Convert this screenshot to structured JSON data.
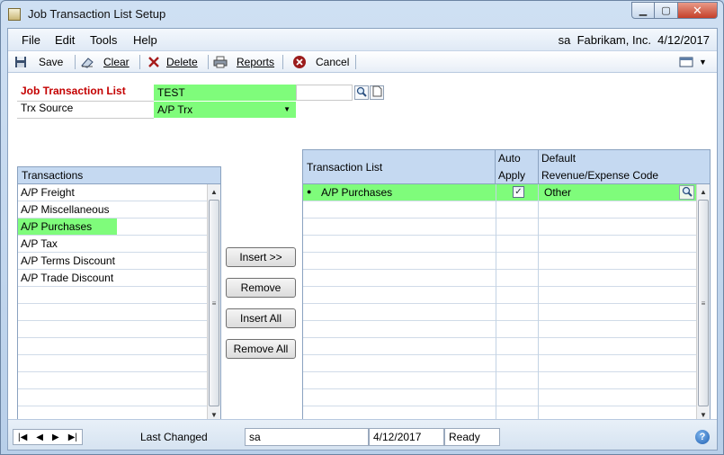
{
  "window": {
    "title": "Job Transaction List Setup"
  },
  "menu": {
    "items": [
      "File",
      "Edit",
      "Tools",
      "Help"
    ],
    "company": "sa  Fabrikam, Inc.  4/12/2017"
  },
  "toolbar": {
    "save": "Save",
    "clear": "Clear",
    "delete": "Delete",
    "reports": "Reports",
    "cancel": "Cancel"
  },
  "form": {
    "job_list_label": "Job Transaction List",
    "job_list_value": "TEST",
    "trx_source_label": "Trx Source",
    "trx_source_value": "A/P Trx"
  },
  "transactions": {
    "header": "Transactions",
    "items": [
      "A/P Freight",
      "A/P Miscellaneous",
      "A/P Purchases",
      "A/P Tax",
      "A/P Terms Discount",
      "A/P Trade Discount"
    ],
    "selected": "A/P Purchases"
  },
  "buttons": {
    "insert": "Insert >>",
    "remove": "Remove",
    "insert_all": "Insert All",
    "remove_all": "Remove All"
  },
  "trx_list": {
    "col_list": "Transaction List",
    "col_auto_1": "Auto",
    "col_auto_2": "Apply",
    "col_default_1": "Default",
    "col_default_2": "Revenue/Expense Code",
    "rows": [
      {
        "name": "A/P Purchases",
        "auto_apply": true,
        "code": "Other"
      }
    ]
  },
  "status": {
    "last_changed_label": "Last Changed",
    "user": "sa",
    "date": "4/12/2017",
    "state": "Ready"
  },
  "colors": {
    "highlight": "#7ffc7b",
    "header_blue": "#c5d9f1",
    "required_red": "#c40000"
  }
}
